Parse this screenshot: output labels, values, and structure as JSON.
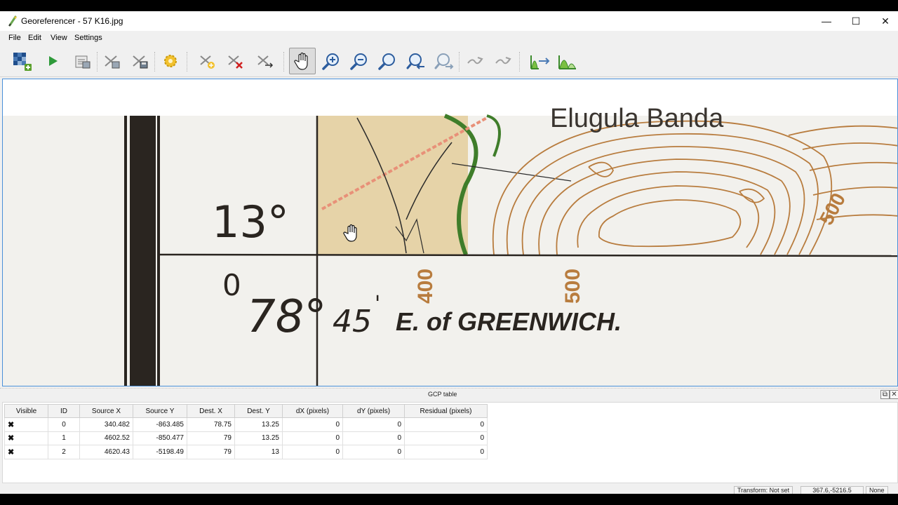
{
  "window": {
    "title": "Georeferencer - 57 K16.jpg",
    "controls": {
      "minimize": "—",
      "maximize": "☐",
      "close": "✕"
    }
  },
  "menu": {
    "items": [
      "File",
      "Edit",
      "View",
      "Settings"
    ]
  },
  "toolbar": {
    "buttons": [
      {
        "name": "open-raster-icon"
      },
      {
        "name": "start-georeferencing-icon"
      },
      {
        "name": "generate-gdal-script-icon"
      },
      {
        "name": "load-gcp-points-icon"
      },
      {
        "name": "save-gcp-points-icon"
      },
      {
        "name": "transformation-settings-icon"
      },
      {
        "name": "add-point-icon"
      },
      {
        "name": "delete-point-icon"
      },
      {
        "name": "move-gcp-point-icon"
      },
      {
        "name": "pan-icon",
        "active": true
      },
      {
        "name": "zoom-in-icon"
      },
      {
        "name": "zoom-out-icon"
      },
      {
        "name": "zoom-to-layer-icon"
      },
      {
        "name": "zoom-last-icon"
      },
      {
        "name": "zoom-next-icon"
      },
      {
        "name": "link-georeferencer-to-qgis-icon"
      },
      {
        "name": "link-qgis-to-georeferencer-icon"
      },
      {
        "name": "full-histogram-stretch-icon"
      },
      {
        "name": "local-histogram-stretch-icon"
      }
    ]
  },
  "map": {
    "labels": {
      "lat_degrees": "13°",
      "lat_minutes": "0",
      "lon_degrees": "78°",
      "lon_minutes": "45",
      "lon_minutes_mark": "'",
      "greenwich": "E. of GREENWICH.",
      "place_name": "Elugula Banda",
      "contour_400": "400",
      "contour_500_a": "500",
      "contour_500_b": "500"
    },
    "colors": {
      "paper": "#f2f1ed",
      "tan": "#e6d3a8",
      "contour": "#b87c3e",
      "green": "#3f7d2a",
      "red_road": "#e89078",
      "ink": "#2a2520"
    }
  },
  "gcp_table": {
    "title": "GCP table",
    "columns": [
      "Visible",
      "ID",
      "Source X",
      "Source Y",
      "Dest. X",
      "Dest. Y",
      "dX (pixels)",
      "dY (pixels)",
      "Residual (pixels)"
    ],
    "rows": [
      {
        "visible": "✖",
        "id": "0",
        "source_x": "340.482",
        "source_y": "-863.485",
        "dest_x": "78.75",
        "dest_y": "13.25",
        "dx": "0",
        "dy": "0",
        "residual": "0"
      },
      {
        "visible": "✖",
        "id": "1",
        "source_x": "4602.52",
        "source_y": "-850.477",
        "dest_x": "79",
        "dest_y": "13.25",
        "dx": "0",
        "dy": "0",
        "residual": "0"
      },
      {
        "visible": "✖",
        "id": "2",
        "source_x": "4620.43",
        "source_y": "-5198.49",
        "dest_x": "79",
        "dest_y": "13",
        "dx": "0",
        "dy": "0",
        "residual": "0"
      }
    ]
  },
  "status": {
    "transform": "Transform: Not set",
    "coordinates": "367.6,-5216.5",
    "crs": "None"
  }
}
